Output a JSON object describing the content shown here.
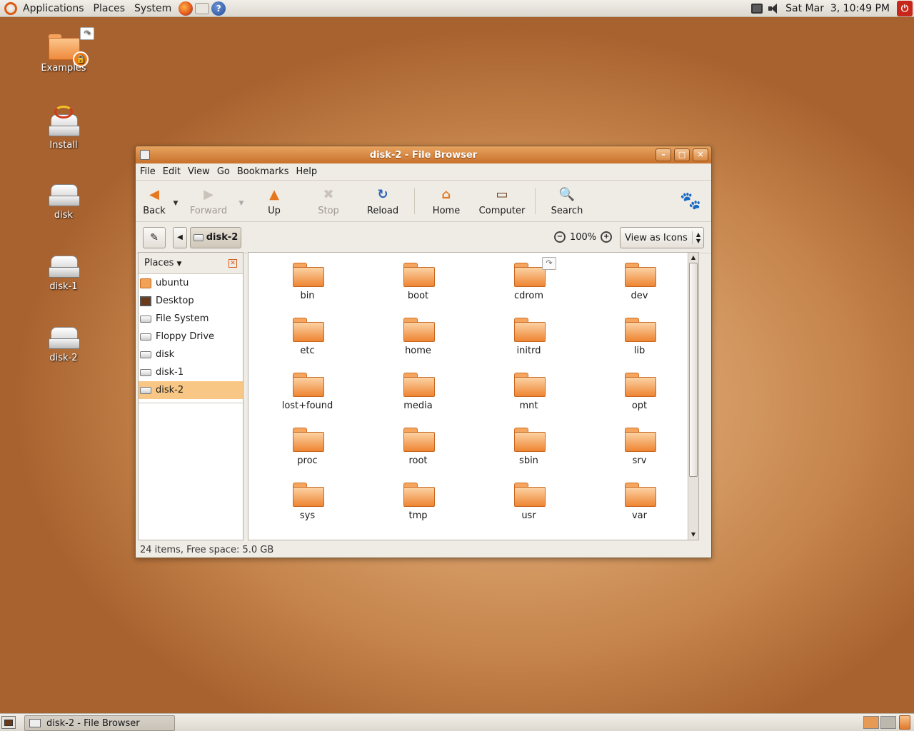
{
  "top_panel": {
    "menus": [
      "Applications",
      "Places",
      "System"
    ],
    "launchers": [
      "firefox-icon",
      "mail-icon",
      "help-icon"
    ],
    "clock": "Sat Mar  3, 10:49 PM"
  },
  "desktop": {
    "icons": [
      {
        "label": "Examples",
        "icon": "folder-icon"
      },
      {
        "label": "Install",
        "icon": "install-icon"
      },
      {
        "label": "disk",
        "icon": "drive-icon"
      },
      {
        "label": "disk-1",
        "icon": "drive-icon"
      },
      {
        "label": "disk-2",
        "icon": "drive-icon"
      }
    ]
  },
  "window": {
    "title": "disk-2 - File Browser",
    "menu": [
      "File",
      "Edit",
      "View",
      "Go",
      "Bookmarks",
      "Help"
    ],
    "toolbar": {
      "back": "Back",
      "forward": "Forward",
      "up": "Up",
      "stop": "Stop",
      "reload": "Reload",
      "home": "Home",
      "computer": "Computer",
      "search": "Search"
    },
    "location": {
      "path_button": "disk-2",
      "zoom": "100%",
      "view_mode": "View as Icons"
    },
    "sidebar": {
      "header": "Places",
      "items": [
        "ubuntu",
        "Desktop",
        "File System",
        "Floppy Drive",
        "disk",
        "disk-1",
        "disk-2"
      ],
      "selected": "disk-2"
    },
    "files": [
      "bin",
      "boot",
      "cdrom",
      "dev",
      "etc",
      "home",
      "initrd",
      "lib",
      "lost+found",
      "media",
      "mnt",
      "opt",
      "proc",
      "root",
      "sbin",
      "srv",
      "sys",
      "tmp",
      "usr",
      "var"
    ],
    "status": "24 items, Free space: 5.0 GB"
  },
  "taskbar": {
    "task": "disk-2 - File Browser"
  },
  "colors": {
    "accent": "#e68a3c",
    "selection": "#f8c785",
    "titlebar": "#d98140"
  }
}
